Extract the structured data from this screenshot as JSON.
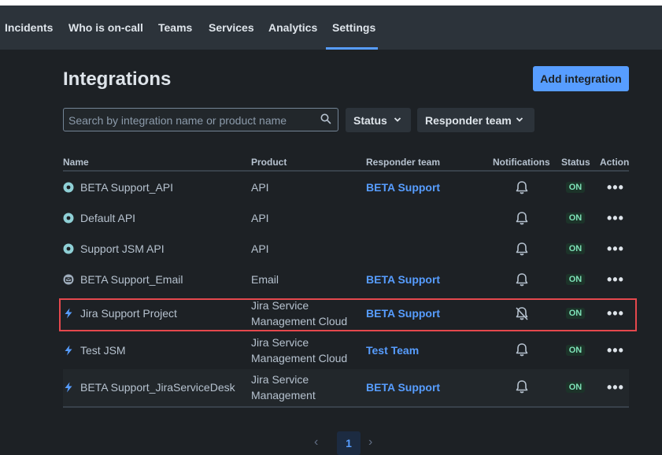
{
  "nav": {
    "items": [
      "Incidents",
      "Who is on-call",
      "Teams",
      "Services",
      "Analytics",
      "Settings"
    ],
    "active": "Settings"
  },
  "page": {
    "title": "Integrations",
    "add_button": "Add integration"
  },
  "filters": {
    "search_placeholder": "Search by integration name or product name",
    "status_label": "Status",
    "responder_label": "Responder team"
  },
  "table": {
    "headers": {
      "name": "Name",
      "product": "Product",
      "team": "Responder team",
      "notifications": "Notifications",
      "status": "Status",
      "action": "Action"
    },
    "rows": [
      {
        "name": "BETA Support_API",
        "icon": "api-gear-icon",
        "product": [
          "API"
        ],
        "team": "BETA Support",
        "notifications": "on",
        "status": "ON"
      },
      {
        "name": "Default API",
        "icon": "api-gear-icon",
        "product": [
          "API"
        ],
        "team": "",
        "notifications": "on",
        "status": "ON"
      },
      {
        "name": "Support JSM API",
        "icon": "api-gear-icon",
        "product": [
          "API"
        ],
        "team": "",
        "notifications": "on",
        "status": "ON"
      },
      {
        "name": "BETA Support_Email",
        "icon": "email-icon",
        "product": [
          "Email"
        ],
        "team": "BETA Support",
        "notifications": "on",
        "status": "ON"
      },
      {
        "name": "Jira Support Project",
        "icon": "jira-bolt-icon",
        "product": [
          "Jira Service",
          "Management Cloud"
        ],
        "team": "BETA Support",
        "notifications": "muted",
        "status": "ON"
      },
      {
        "name": "Test JSM",
        "icon": "jira-bolt-icon",
        "product": [
          "Jira Service",
          "Management Cloud"
        ],
        "team": "Test Team",
        "notifications": "on",
        "status": "ON"
      },
      {
        "name": "BETA Support_JiraServiceDesk",
        "icon": "jira-bolt-icon",
        "product": [
          "Jira Service",
          "Management"
        ],
        "team": "BETA Support",
        "notifications": "on",
        "status": "ON"
      }
    ]
  },
  "pagination": {
    "current_page": "1"
  },
  "colors": {
    "accent": "#579dff",
    "status_on_text": "#7ee2b8",
    "status_on_bg": "#1c3329",
    "highlight_border": "#e5484d"
  }
}
